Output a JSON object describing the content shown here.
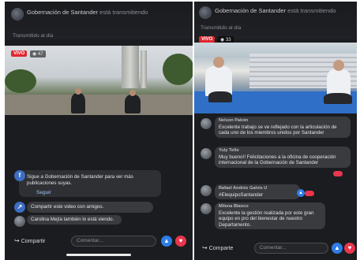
{
  "left": {
    "page_name": "Gobernación de Santander",
    "status": "está transmitiendo",
    "subtitle": "Transmitido al día",
    "live_badge": "VIVO",
    "viewers": "47",
    "suggestion_text": "Sigue a Gobernación de Santander para ver más publicaciones suyas.",
    "follow_label": "Seguir",
    "share_video_text": "Compartir este video con amigos.",
    "comment_name": "Carolina Mejía",
    "comment_text": "también lo está viendo.",
    "share_label": "Compartir",
    "comment_placeholder": "Comentar...",
    "icons": {
      "like": "thumbs-up-icon",
      "heart": "heart-icon",
      "share": "share-arrow-icon"
    }
  },
  "right": {
    "page_name": "Gobernación de Santander",
    "status": "está transmitiendo",
    "subtitle": "Transmitido al día",
    "live_badge": "VIVO",
    "viewers": "33",
    "comments": [
      {
        "name": "Nelson Pabón",
        "text": "Excelente trabajo se ve reflejado con la articulación de cada uno de los miembros unidos por Santander"
      },
      {
        "name": "Yuly Tello",
        "text": "Muy bueno!! Felicitaciones a la oficina de cooperación internacional de la Gobernación de Santander"
      },
      {
        "name": "Rafael Andrés Galvis U",
        "text": "#ElequipoSantander"
      },
      {
        "name": "Milena Blanco",
        "text": "Excelente la gestión realizada por este gran equipo en pro del bienestar de nuestro Departamento."
      }
    ],
    "share_label": "Comparte",
    "comment_placeholder": "Comentar...",
    "icons": {
      "like": "thumbs-up-icon",
      "heart": "heart-icon",
      "share": "share-arrow-icon"
    }
  },
  "colors": {
    "live": "#e0262f",
    "like": "#2d7de6",
    "heart": "#e8364d",
    "link": "#9fc1f7",
    "background": "#1b1c1f"
  }
}
